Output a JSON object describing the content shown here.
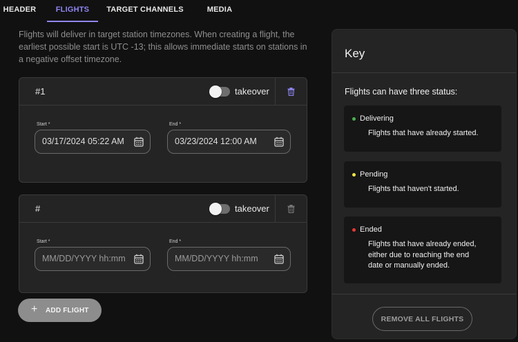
{
  "tabs": [
    {
      "label": "HEADER",
      "active": false
    },
    {
      "label": "FLIGHTS",
      "active": true
    },
    {
      "label": "TARGET CHANNELS",
      "active": false
    },
    {
      "label": "MEDIA",
      "active": false
    }
  ],
  "intro": "Flights will deliver in target station timezones. When creating a flight, the earliest possible start is UTC -13; this allows immediate starts on stations in a negative offset timezone.",
  "flights": [
    {
      "number": "#1",
      "toggle_label": "takeover",
      "takeover_on": false,
      "start_label": "Start *",
      "start_value": "03/17/2024 05:22 AM",
      "end_label": "End *",
      "end_value": "03/23/2024 12:00 AM",
      "delete_enabled": true
    },
    {
      "number": "#",
      "toggle_label": "takeover",
      "takeover_on": false,
      "start_label": "Start *",
      "start_placeholder": "MM/DD/YYYY hh:mm aa",
      "end_label": "End *",
      "end_placeholder": "MM/DD/YYYY hh:mm aa",
      "delete_enabled": false
    }
  ],
  "add_flight_label": "ADD FLIGHT",
  "key": {
    "title": "Key",
    "subtitle": "Flights can have three status:",
    "statuses": [
      {
        "name": "Delivering",
        "color": "#4caf50",
        "description": "Flights that have already started."
      },
      {
        "name": "Pending",
        "color": "#f0e442",
        "description": "Flights that haven't started."
      },
      {
        "name": "Ended",
        "color": "#e53935",
        "description": "Flights that have already ended, either due to reaching the end date or manually ended."
      }
    ],
    "remove_all_label": "REMOVE ALL FLIGHTS"
  },
  "colors": {
    "accent": "#8f86f3",
    "background": "#111111",
    "card": "#242424"
  },
  "icons": {
    "delete": "trash-icon",
    "calendar": "calendar-icon",
    "add": "plus-icon"
  }
}
